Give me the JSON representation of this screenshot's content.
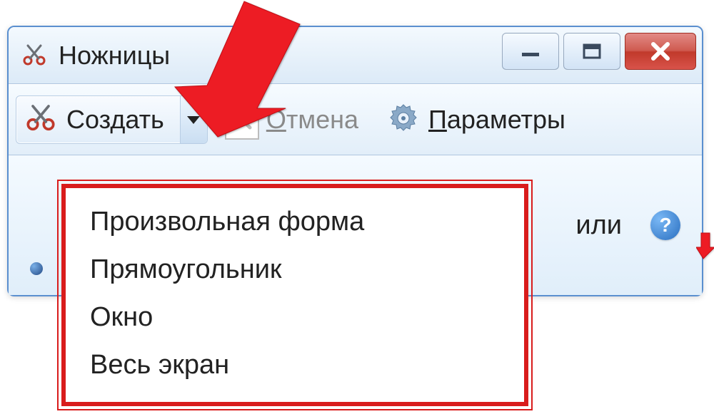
{
  "window": {
    "title": "Ножницы"
  },
  "toolbar": {
    "new_label": "Создать",
    "cancel_prefix": "О",
    "cancel_rest": "тмена",
    "options_prefix": "П",
    "options_rest": "араметры"
  },
  "lower": {
    "partial_visible": "или"
  },
  "dropdown": {
    "items": [
      "Произвольная форма",
      "Прямоугольник",
      "Окно",
      "Весь экран"
    ]
  }
}
